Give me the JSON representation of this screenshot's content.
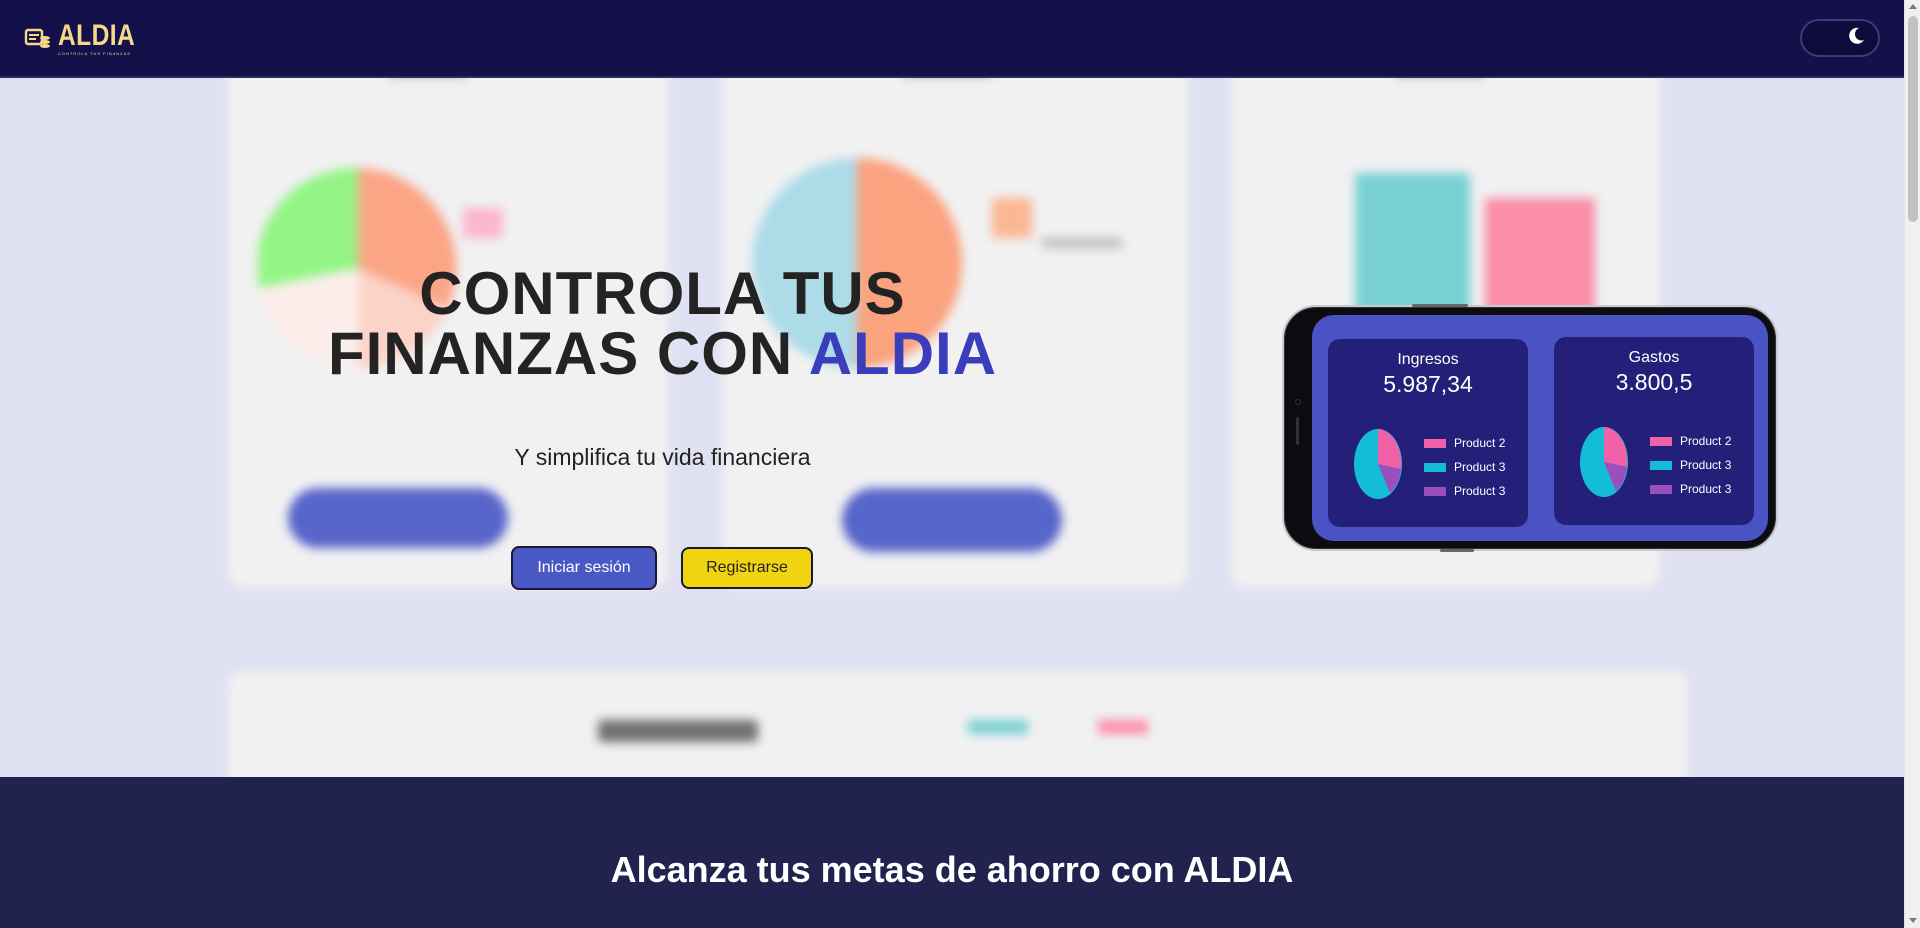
{
  "header": {
    "logo_text": "ALDIA",
    "logo_tagline": "CONTROLA TUS FINANZAS",
    "theme_toggle_icon": "moon-icon"
  },
  "hero": {
    "title_line1": "CONTROLA TUS",
    "title_line2_prefix": "FINANZAS CON",
    "title_accent": "ALDIA",
    "subtitle": "Y simplifica tu vida financiera",
    "login_label": "Iniciar sesión",
    "register_label": "Registrarse"
  },
  "phone": {
    "income": {
      "title": "Ingresos",
      "value": "5.987,34",
      "legend": [
        "Product 2",
        "Product 3",
        "Product 3"
      ]
    },
    "expenses": {
      "title": "Gastos",
      "value": "3.800,5",
      "legend": [
        "Product 2",
        "Product 3",
        "Product 3"
      ]
    },
    "colors": [
      "#f061a8",
      "#14bcd6",
      "#9a4fbd"
    ]
  },
  "banner": {
    "title": "Alcanza tus metas de ahorro con ALDIA"
  },
  "colors": {
    "navbar": "#13104a",
    "accent": "#3a3ebd",
    "login_button": "#4a58c6",
    "register_button": "#f0d410",
    "band": "#22224f"
  }
}
